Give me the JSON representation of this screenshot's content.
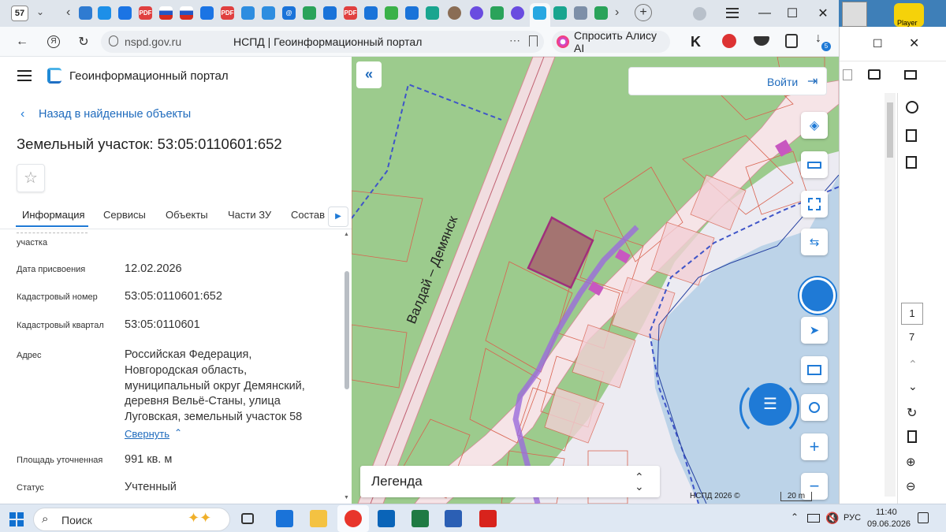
{
  "browser": {
    "tab_count": "57",
    "url_host": "nspd.gov.ru",
    "tab_title": "НСПД | Геоинформационный портал",
    "alice_label": "Спросить Алису AI",
    "download_badge": "5"
  },
  "portal": {
    "title": "Геоинформационный портал",
    "back_link": "Назад в найденные объекты",
    "object_title": "Земельный участок: 53:05:0110601:652",
    "tabs": [
      "Информация",
      "Сервисы",
      "Объекты",
      "Части ЗУ",
      "Состав"
    ],
    "rows": [
      {
        "label": "участка",
        "value": ""
      },
      {
        "label": "Дата присвоения",
        "value": "12.02.2026"
      },
      {
        "label": "Кадастровый номер",
        "value": "53:05:0110601:652"
      },
      {
        "label": "Кадастровый квартал",
        "value": "53:05:0110601"
      },
      {
        "label": "Адрес",
        "value_lines": [
          "Российская Федерация,",
          "Новгородская область,",
          "муниципальный округ Демянский,",
          "деревня Вельё-Станы, улица",
          "Луговская, земельный участок 58"
        ]
      },
      {
        "label": "Площадь уточненная",
        "value": "991 кв. м"
      },
      {
        "label": "Статус",
        "value": "Учтенный"
      }
    ],
    "collapse_link": "Свернуть"
  },
  "map": {
    "login_label": "Войти",
    "road_label": "Валдай – Демянск",
    "legend_label": "Легенда",
    "copyright": "НСПД 2026 ©",
    "scale": "20 m"
  },
  "viewer": {
    "page_current": "1",
    "page_total": "7"
  },
  "desktop": {
    "player_label": "Player"
  },
  "taskbar": {
    "search_placeholder": "Поиск",
    "lang": "РУС",
    "time": "11:40",
    "date": "09.06.2026"
  },
  "colors": {
    "accent": "#1f7ad6",
    "selected_parcel": "#a0207a",
    "map_green": "#9ccb8d",
    "water": "#bcd3e8"
  }
}
